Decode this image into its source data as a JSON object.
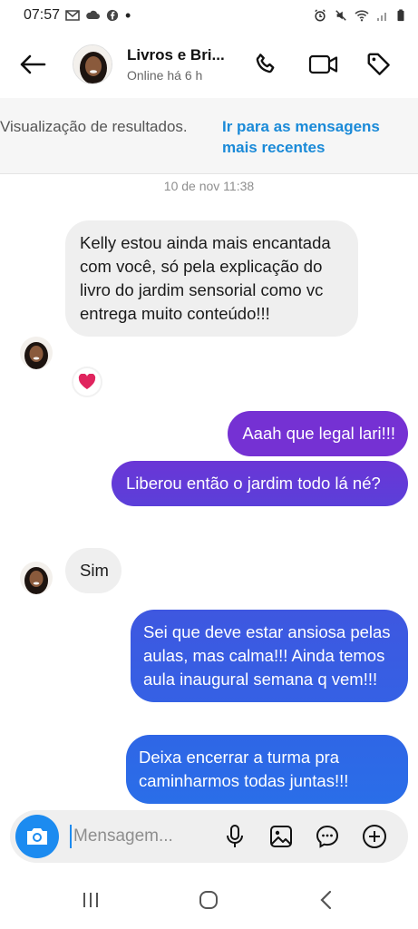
{
  "status_bar": {
    "time": "07:57"
  },
  "header": {
    "contact_name": "Livros e Bri...",
    "contact_status": "Online há 6 h"
  },
  "banner": {
    "text": "Visualização de resultados.",
    "link": "Ir para as mensagens mais recentes"
  },
  "timestamp": "10 de nov 11:38",
  "messages": [
    {
      "direction": "in",
      "text": "Kelly estou ainda mais encantada com você, só pela explicação do livro do jardim sensorial como vc entrega muito conteúdo!!!"
    },
    {
      "direction": "out",
      "text": "Aaah que legal lari!!!"
    },
    {
      "direction": "out",
      "text": "Liberou então o jardim todo lá né?"
    },
    {
      "direction": "in",
      "text": "Sim"
    },
    {
      "direction": "out",
      "text": "Sei que deve estar ansiosa pelas aulas, mas calma!!! Ainda temos aula inaugural semana q vem!!!"
    },
    {
      "direction": "out",
      "text": "Deixa encerrar a turma pra caminharmos todas juntas!!!"
    }
  ],
  "reaction": {
    "icon": "heart-icon",
    "color": "#e0245e"
  },
  "composer": {
    "placeholder": "Mensagem..."
  },
  "colors": {
    "accent": "#1c8bf0",
    "link": "#1a8ad8",
    "gradient_top": "#7a2fd0",
    "gradient_bottom": "#2f5fe0"
  }
}
